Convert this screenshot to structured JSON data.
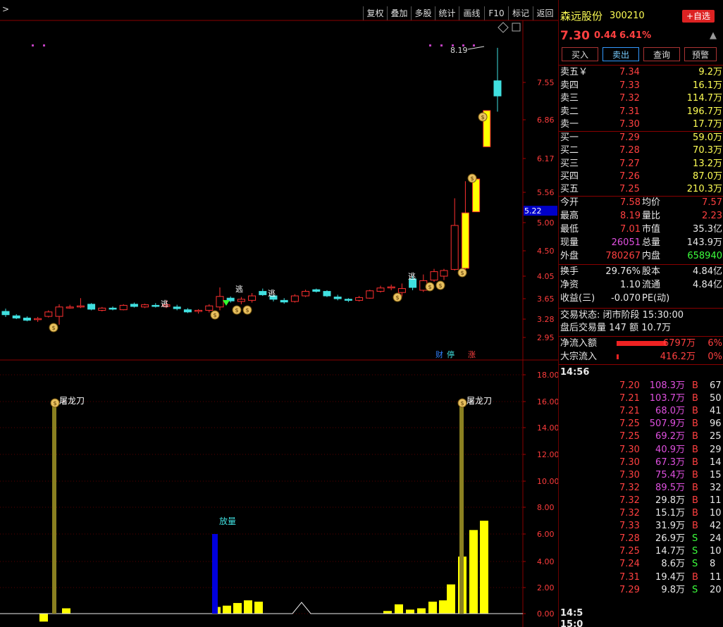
{
  "toolbar": {
    "expand_label": ">",
    "buttons": [
      "复权",
      "叠加",
      "多股",
      "统计",
      "画线",
      "F10",
      "标记",
      "返回"
    ]
  },
  "stock": {
    "name": "森远股份",
    "code": "300210",
    "price": "7.30",
    "change": "0.44",
    "change_pct": "6.41%",
    "add_fav_label": "+自选"
  },
  "trade_buttons": [
    "买入",
    "卖出",
    "查询",
    "预警"
  ],
  "sell_orders": [
    {
      "label": "卖五￥",
      "price": "7.34",
      "vol": "9.2万"
    },
    {
      "label": "卖四",
      "price": "7.33",
      "vol": "16.1万"
    },
    {
      "label": "卖三",
      "price": "7.32",
      "vol": "114.7万"
    },
    {
      "label": "卖二",
      "price": "7.31",
      "vol": "196.7万"
    },
    {
      "label": "卖一",
      "price": "7.30",
      "vol": "17.7万"
    }
  ],
  "buy_orders": [
    {
      "label": "买一",
      "price": "7.29",
      "vol": "59.0万"
    },
    {
      "label": "买二",
      "price": "7.28",
      "vol": "70.3万"
    },
    {
      "label": "买三",
      "price": "7.27",
      "vol": "13.2万"
    },
    {
      "label": "买四",
      "price": "7.26",
      "vol": "87.0万"
    },
    {
      "label": "买五",
      "price": "7.25",
      "vol": "210.3万"
    }
  ],
  "quote": [
    {
      "l1": "今开",
      "v1": "7.58",
      "c1": "red",
      "l2": "均价",
      "v2": "7.57",
      "c2": "red"
    },
    {
      "l1": "最高",
      "v1": "8.19",
      "c1": "red",
      "l2": "量比",
      "v2": "2.23",
      "c2": "red"
    },
    {
      "l1": "最低",
      "v1": "7.01",
      "c1": "red",
      "l2": "市值",
      "v2": "35.3亿",
      "c2": "wht"
    },
    {
      "l1": "现量",
      "v1": "26051",
      "c1": "mag",
      "l2": "总量",
      "v2": "143.9万",
      "c2": "wht"
    },
    {
      "l1": "外盘",
      "v1": "780267",
      "c1": "red",
      "l2": "内盘",
      "v2": "658940",
      "c2": "green"
    }
  ],
  "fundamentals": [
    {
      "l1": "换手",
      "v1": "29.76%",
      "l2": "股本",
      "v2": "4.84亿"
    },
    {
      "l1": "净资",
      "v1": "1.10",
      "l2": "流通",
      "v2": "4.84亿"
    },
    {
      "l1": "收益(三)",
      "v1": "-0.070",
      "l2": "PE(动)",
      "v2": ""
    }
  ],
  "status": {
    "trade_state": "交易状态: 闭市阶段 15:30:00",
    "after_hours": "盘后交易量 147 额 10.7万"
  },
  "flows": [
    {
      "label": "净流入额",
      "value": "6797万",
      "pct": "6%",
      "bar": 0.5
    },
    {
      "label": "大宗流入",
      "value": "416.2万",
      "pct": "0%",
      "bar": 0.02
    }
  ],
  "ticks_head": "14:56",
  "ticks": [
    {
      "p": "7.20",
      "v": "108.3万",
      "s": "B",
      "n": "67",
      "pc": "red",
      "vc": "mag"
    },
    {
      "p": "7.21",
      "v": "103.7万",
      "s": "B",
      "n": "50",
      "pc": "red",
      "vc": "mag"
    },
    {
      "p": "7.21",
      "v": "68.0万",
      "s": "B",
      "n": "41",
      "pc": "red",
      "vc": "mag"
    },
    {
      "p": "7.25",
      "v": "507.9万",
      "s": "B",
      "n": "96",
      "pc": "red",
      "vc": "mag"
    },
    {
      "p": "7.25",
      "v": "69.2万",
      "s": "B",
      "n": "25",
      "pc": "red",
      "vc": "mag"
    },
    {
      "p": "7.30",
      "v": "40.9万",
      "s": "B",
      "n": "29",
      "pc": "red",
      "vc": "mag"
    },
    {
      "p": "7.30",
      "v": "67.3万",
      "s": "B",
      "n": "14",
      "pc": "red",
      "vc": "mag"
    },
    {
      "p": "7.30",
      "v": "75.4万",
      "s": "B",
      "n": "15",
      "pc": "red",
      "vc": "mag"
    },
    {
      "p": "7.32",
      "v": "89.5万",
      "s": "B",
      "n": "32",
      "pc": "red",
      "vc": "mag"
    },
    {
      "p": "7.32",
      "v": "29.8万",
      "s": "B",
      "n": "11",
      "pc": "red",
      "vc": "wht"
    },
    {
      "p": "7.32",
      "v": "15.1万",
      "s": "B",
      "n": "10",
      "pc": "red",
      "vc": "wht"
    },
    {
      "p": "7.33",
      "v": "31.9万",
      "s": "B",
      "n": "42",
      "pc": "red",
      "vc": "wht"
    },
    {
      "p": "7.28",
      "v": "26.9万",
      "s": "S",
      "n": "24",
      "pc": "red",
      "vc": "wht"
    },
    {
      "p": "7.25",
      "v": "14.7万",
      "s": "S",
      "n": "10",
      "pc": "red",
      "vc": "wht"
    },
    {
      "p": "7.24",
      "v": "8.6万",
      "s": "S",
      "n": "8",
      "pc": "red",
      "vc": "wht"
    },
    {
      "p": "7.31",
      "v": "19.4万",
      "s": "B",
      "n": "11",
      "pc": "red",
      "vc": "wht"
    },
    {
      "p": "7.29",
      "v": "9.8万",
      "s": "S",
      "n": "20",
      "pc": "red",
      "vc": "wht"
    }
  ],
  "ticks_foot": [
    "14:5",
    "15:0"
  ],
  "price_axis": {
    "ticks": [
      "7.55",
      "6.86",
      "6.17",
      "5.56",
      "5.00",
      "4.50",
      "4.05",
      "3.65",
      "3.28",
      "2.95"
    ],
    "current_label": "5.22",
    "high_label": "8.19"
  },
  "markers": {
    "escape": "逃",
    "money": "$",
    "badges": [
      "财",
      "停",
      "涨"
    ]
  },
  "volume_axis": {
    "ticks": [
      "18.00",
      "16.00",
      "14.00",
      "12.00",
      "10.00",
      "8.00",
      "6.00",
      "4.00",
      "2.00",
      "0.00"
    ],
    "labels": {
      "butcher": "屠龙刀",
      "surge": "放量"
    }
  },
  "chart_data": {
    "type": "candlestick",
    "price_ticks": [
      7.55,
      6.86,
      6.17,
      5.56,
      5.0,
      4.5,
      4.05,
      3.65,
      3.28,
      2.95
    ],
    "current_price_line": 5.22,
    "candles": [
      {
        "o": 3.42,
        "h": 3.47,
        "l": 3.32,
        "c": 3.36,
        "up": false
      },
      {
        "o": 3.34,
        "h": 3.37,
        "l": 3.28,
        "c": 3.3,
        "up": false
      },
      {
        "o": 3.3,
        "h": 3.33,
        "l": 3.24,
        "c": 3.26,
        "up": false
      },
      {
        "o": 3.27,
        "h": 3.32,
        "l": 3.23,
        "c": 3.29,
        "up": true
      },
      {
        "o": 3.33,
        "h": 3.44,
        "l": 3.31,
        "c": 3.41,
        "up": true
      },
      {
        "o": 3.33,
        "h": 3.55,
        "l": 3.18,
        "c": 3.5,
        "up": true
      },
      {
        "o": 3.5,
        "h": 3.54,
        "l": 3.47,
        "c": 3.5,
        "up": true
      },
      {
        "o": 3.5,
        "h": 3.66,
        "l": 3.48,
        "c": 3.52,
        "up": true
      },
      {
        "o": 3.55,
        "h": 3.57,
        "l": 3.44,
        "c": 3.46,
        "up": false
      },
      {
        "o": 3.44,
        "h": 3.5,
        "l": 3.42,
        "c": 3.48,
        "up": true
      },
      {
        "o": 3.48,
        "h": 3.51,
        "l": 3.44,
        "c": 3.46,
        "up": false
      },
      {
        "o": 3.45,
        "h": 3.55,
        "l": 3.44,
        "c": 3.53,
        "up": true
      },
      {
        "o": 3.55,
        "h": 3.58,
        "l": 3.49,
        "c": 3.51,
        "up": false
      },
      {
        "o": 3.5,
        "h": 3.56,
        "l": 3.48,
        "c": 3.54,
        "up": true
      },
      {
        "o": 3.53,
        "h": 3.57,
        "l": 3.49,
        "c": 3.51,
        "up": false
      },
      {
        "o": 3.51,
        "h": 3.62,
        "l": 3.48,
        "c": 3.54,
        "up": true
      },
      {
        "o": 3.5,
        "h": 3.54,
        "l": 3.44,
        "c": 3.47,
        "up": false
      },
      {
        "o": 3.45,
        "h": 3.48,
        "l": 3.39,
        "c": 3.41,
        "up": false
      },
      {
        "o": 3.42,
        "h": 3.46,
        "l": 3.38,
        "c": 3.44,
        "up": true
      },
      {
        "o": 3.44,
        "h": 3.55,
        "l": 3.4,
        "c": 3.52,
        "up": true
      },
      {
        "o": 3.5,
        "h": 3.85,
        "l": 3.44,
        "c": 3.69,
        "up": true
      },
      {
        "o": 3.66,
        "h": 3.69,
        "l": 3.58,
        "c": 3.61,
        "up": false
      },
      {
        "o": 3.6,
        "h": 3.68,
        "l": 3.55,
        "c": 3.64,
        "up": true
      },
      {
        "o": 3.62,
        "h": 3.75,
        "l": 3.58,
        "c": 3.7,
        "up": true
      },
      {
        "o": 3.78,
        "h": 3.83,
        "l": 3.7,
        "c": 3.72,
        "up": false
      },
      {
        "o": 3.7,
        "h": 3.72,
        "l": 3.6,
        "c": 3.64,
        "up": false
      },
      {
        "o": 3.62,
        "h": 3.66,
        "l": 3.56,
        "c": 3.59,
        "up": false
      },
      {
        "o": 3.6,
        "h": 3.73,
        "l": 3.58,
        "c": 3.7,
        "up": true
      },
      {
        "o": 3.7,
        "h": 3.81,
        "l": 3.68,
        "c": 3.78,
        "up": true
      },
      {
        "o": 3.81,
        "h": 3.83,
        "l": 3.76,
        "c": 3.78,
        "up": false
      },
      {
        "o": 3.78,
        "h": 3.8,
        "l": 3.68,
        "c": 3.7,
        "up": false
      },
      {
        "o": 3.68,
        "h": 3.72,
        "l": 3.62,
        "c": 3.65,
        "up": false
      },
      {
        "o": 3.64,
        "h": 3.66,
        "l": 3.59,
        "c": 3.62,
        "up": false
      },
      {
        "o": 3.62,
        "h": 3.7,
        "l": 3.6,
        "c": 3.67,
        "up": true
      },
      {
        "o": 3.66,
        "h": 3.81,
        "l": 3.65,
        "c": 3.79,
        "up": true
      },
      {
        "o": 3.78,
        "h": 3.88,
        "l": 3.76,
        "c": 3.84,
        "up": true
      },
      {
        "o": 3.85,
        "h": 3.9,
        "l": 3.8,
        "c": 3.86,
        "up": true
      },
      {
        "o": 3.76,
        "h": 3.92,
        "l": 3.69,
        "c": 3.83,
        "up": true
      },
      {
        "o": 3.85,
        "h": 4.05,
        "l": 3.8,
        "c": 4.0,
        "up": false
      },
      {
        "o": 3.8,
        "h": 4.08,
        "l": 3.77,
        "c": 3.97,
        "up": true
      },
      {
        "o": 3.98,
        "h": 4.18,
        "l": 3.95,
        "c": 4.13,
        "up": true
      },
      {
        "o": 4.05,
        "h": 4.18,
        "l": 3.98,
        "c": 4.15,
        "up": true
      },
      {
        "o": 4.17,
        "h": 5.45,
        "l": 4.15,
        "c": 4.95,
        "up": true
      },
      {
        "o": 4.19,
        "h": 5.76,
        "l": 4.17,
        "c": 5.18,
        "up": true
      },
      {
        "o": 5.2,
        "h": 5.85,
        "l": 5.2,
        "c": 5.8,
        "up": true
      },
      {
        "o": 6.38,
        "h": 7.03,
        "l": 6.38,
        "c": 7.03,
        "up": true
      },
      {
        "o": 7.58,
        "h": 8.19,
        "l": 7.01,
        "c": 7.3,
        "up": false
      }
    ],
    "volume_ticks": [
      18,
      16,
      14,
      12,
      10,
      8,
      6,
      4,
      2,
      0
    ],
    "volume": [
      {
        "v": -0.6,
        "c": "#ffff00"
      },
      {
        "v": 0.4,
        "c": "#ffff00"
      },
      {
        "v": 0.5,
        "c": "#ffff00"
      },
      {
        "v": 0.6,
        "c": "#ffff00"
      },
      {
        "v": 0.8,
        "c": "#ffff00"
      },
      {
        "v": 1.0,
        "c": "#ffff00"
      },
      {
        "v": 0.9,
        "c": "#ffff00"
      },
      {
        "v": 0.2,
        "c": "#ffff00"
      },
      {
        "v": 0.7,
        "c": "#ffff00"
      },
      {
        "v": 0.3,
        "c": "#ffff00"
      },
      {
        "v": 0.4,
        "c": "#ffff00"
      },
      {
        "v": 0.9,
        "c": "#ffff00"
      },
      {
        "v": 1.0,
        "c": "#ffff00"
      },
      {
        "v": 2.2,
        "c": "#ffff00"
      },
      {
        "v": 4.3,
        "c": "#ffff00"
      },
      {
        "v": 6.3,
        "c": "#ffff00"
      },
      {
        "v": 7.0,
        "c": "#ffff00"
      }
    ],
    "signal_bars": [
      {
        "v": 15.8,
        "label": "屠龙刀"
      },
      {
        "v": 6.0,
        "label": "放量"
      },
      {
        "v": 15.8,
        "label": "屠龙刀"
      }
    ]
  }
}
